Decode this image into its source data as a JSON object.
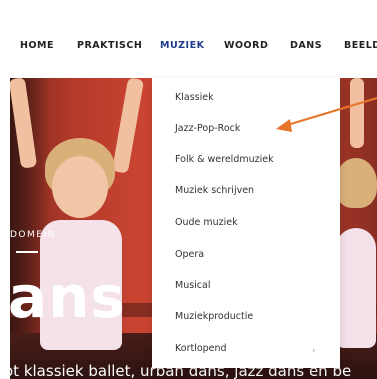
{
  "nav": {
    "items": [
      {
        "label": "HOME"
      },
      {
        "label": "PRAKTISCH"
      },
      {
        "label": "MUZIEK",
        "active": true
      },
      {
        "label": "WOORD"
      },
      {
        "label": "DANS"
      },
      {
        "label": "BEELD"
      }
    ],
    "active_color": "#1f3b8c"
  },
  "hero": {
    "domain_label": "DOMEIN",
    "title": "ans",
    "subtitle": "ot klassiek ballet, urban dans, jazz dans en be"
  },
  "dropdown": {
    "items": [
      {
        "label": "Klassiek"
      },
      {
        "label": "Jazz-Pop-Rock"
      },
      {
        "label": "Folk & wereldmuziek"
      },
      {
        "label": "Muziek schrijven"
      },
      {
        "label": "Oude muziek"
      },
      {
        "label": "Opera"
      },
      {
        "label": "Musical"
      },
      {
        "label": "Muziekproductie"
      },
      {
        "label": "Kortlopend",
        "has_submenu": true
      }
    ],
    "submenu_indicator": "›"
  },
  "annotation": {
    "arrow_color": "#e8732a",
    "points_to": "Jazz-Pop-Rock"
  }
}
